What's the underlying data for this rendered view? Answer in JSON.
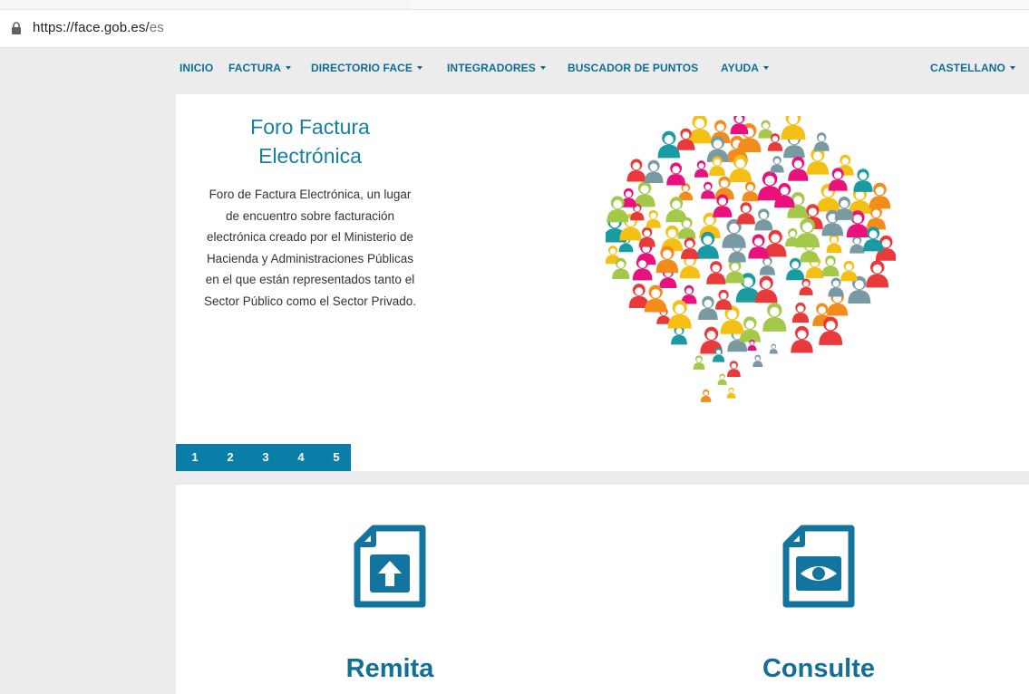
{
  "browser": {
    "url_host": "https://face.gob.es/",
    "url_path": "es",
    "lock_icon": "lock-icon"
  },
  "nav": {
    "items": [
      {
        "label": "INICIO",
        "dropdown": false
      },
      {
        "label": "FACTURA",
        "dropdown": true
      },
      {
        "label": "DIRECTORIO FACE",
        "dropdown": true
      },
      {
        "label": "INTEGRADORES",
        "dropdown": true
      },
      {
        "label": "BUSCADOR DE PUNTOS",
        "dropdown": false
      },
      {
        "label": "AYUDA",
        "dropdown": true
      }
    ],
    "language": {
      "label": "CASTELLANO",
      "dropdown": true
    }
  },
  "hero": {
    "title_line1": "Foro Factura",
    "title_line2": "Electrónica",
    "description": [
      "Foro de Factura Electrónica, un lugar",
      "de encuentro sobre facturación",
      "electrónica creado por el Ministerio de",
      "Hacienda y Administraciones Públicas",
      "en el que están representados tanto el",
      "Sector Público como el Sector Privado."
    ],
    "image_icon": "people-speech-bubble-illustration",
    "pager": [
      "1",
      "2",
      "3",
      "4",
      "5"
    ]
  },
  "cards": [
    {
      "title": "Remita",
      "icon": "document-upload-icon"
    },
    {
      "title": "Consulte",
      "icon": "document-view-icon"
    }
  ],
  "colors": {
    "accent": "#0b7ea7",
    "nav_text": "#0d6f95",
    "title_text": "#1580a4",
    "card_title": "#116f98",
    "icon_blue": "#13759f",
    "page_bg": "#ececec",
    "bubble_palette": [
      "#e9127c",
      "#f28c1d",
      "#a4c84a",
      "#f5c016",
      "#1a9aa1",
      "#7a9aa3",
      "#e83a3a"
    ]
  }
}
